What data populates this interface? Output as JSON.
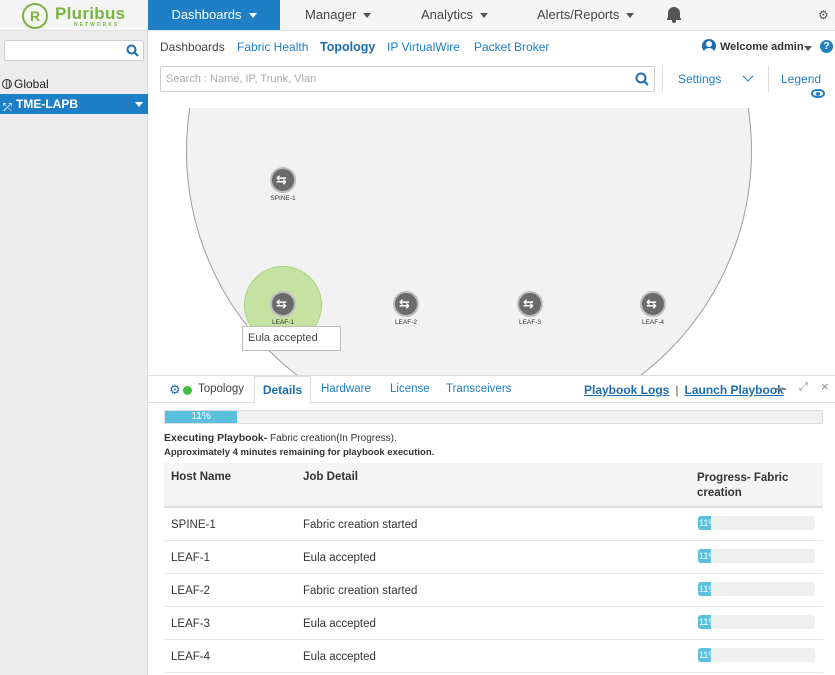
{
  "brand": {
    "name": "Pluribus",
    "sub": "NETWORKS",
    "mark": "R",
    "color": "#7cb342"
  },
  "topnav": {
    "items": [
      "Dashboards",
      "Manager",
      "Analytics",
      "Alerts/Reports"
    ],
    "active": "Dashboards",
    "accent": "#1e7fc6"
  },
  "sidebar": {
    "search_placeholder": "",
    "global_label": "Global",
    "fabric_label": "TME-LAPB"
  },
  "subnav": {
    "tabs": [
      "Dashboards",
      "Fabric Health",
      "Topology",
      "IP VirtualWire",
      "Packet Broker"
    ],
    "active": "Topology",
    "welcome": "Welcome admin"
  },
  "search": {
    "placeholder": "Search : Name, IP, Trunk, Vlan",
    "settings_label": "Settings",
    "legend_label": "Legend"
  },
  "topology": {
    "nodes": [
      {
        "name": "SPINE-1"
      },
      {
        "name": "LEAF-1"
      },
      {
        "name": "LEAF-2"
      },
      {
        "name": "LEAF-3"
      },
      {
        "name": "LEAF-4"
      }
    ],
    "tooltip": "Eula accepted"
  },
  "panel": {
    "tabs": [
      "Topology",
      "Details",
      "Hardware",
      "License",
      "Transceivers"
    ],
    "active_tab": "Details",
    "links": {
      "playbook_logs": "Playbook Logs",
      "separator": "|",
      "launch_playbook": "Launch Playbook"
    },
    "overall_progress": {
      "percent": 11,
      "label": "11%"
    },
    "executing_bold": "Executing Playbook-",
    "executing_rest": " Fabric creation(In Progress).",
    "remaining": "Approximately 4 minutes remaining for playbook execution.",
    "table": {
      "headers": [
        "Host Name",
        "Job Detail",
        "Progress- Fabric creation"
      ],
      "rows": [
        {
          "host": "SPINE-1",
          "job": "Fabric creation started",
          "progress": 11,
          "progress_label": "11%"
        },
        {
          "host": "LEAF-1",
          "job": "Eula accepted",
          "progress": 11,
          "progress_label": "11%"
        },
        {
          "host": "LEAF-2",
          "job": "Fabric creation started",
          "progress": 11,
          "progress_label": "11%"
        },
        {
          "host": "LEAF-3",
          "job": "Eula accepted",
          "progress": 11,
          "progress_label": "11%"
        },
        {
          "host": "LEAF-4",
          "job": "Eula accepted",
          "progress": 11,
          "progress_label": "11%"
        }
      ]
    }
  }
}
